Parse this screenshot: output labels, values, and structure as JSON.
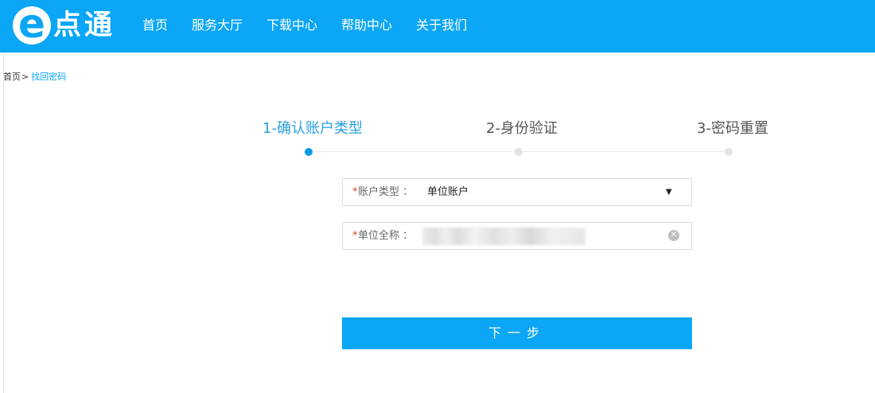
{
  "header": {
    "logo_letter": "e",
    "logo_text": "点通",
    "nav": [
      "首页",
      "服务大厅",
      "下载中心",
      "帮助中心",
      "关于我们"
    ]
  },
  "breadcrumb": {
    "home": "首页",
    "separator": ">",
    "current": "找回密码"
  },
  "steps": [
    {
      "label": "1-确认账户类型",
      "active": true
    },
    {
      "label": "2-身份验证",
      "active": false
    },
    {
      "label": "3-密码重置",
      "active": false
    }
  ],
  "form": {
    "account_type": {
      "required_mark": "*",
      "label": "账户类型 ：",
      "value": "单位账户"
    },
    "org_name": {
      "required_mark": "*",
      "label": "单位全称 ："
    }
  },
  "next_button": "下一步",
  "colors": {
    "primary": "#0ba6f5",
    "active_step": "#2a9fe0",
    "required": "#e8401c"
  },
  "icons": {
    "dropdown": "triangle-down-icon",
    "clear": "clear-circle-icon"
  }
}
